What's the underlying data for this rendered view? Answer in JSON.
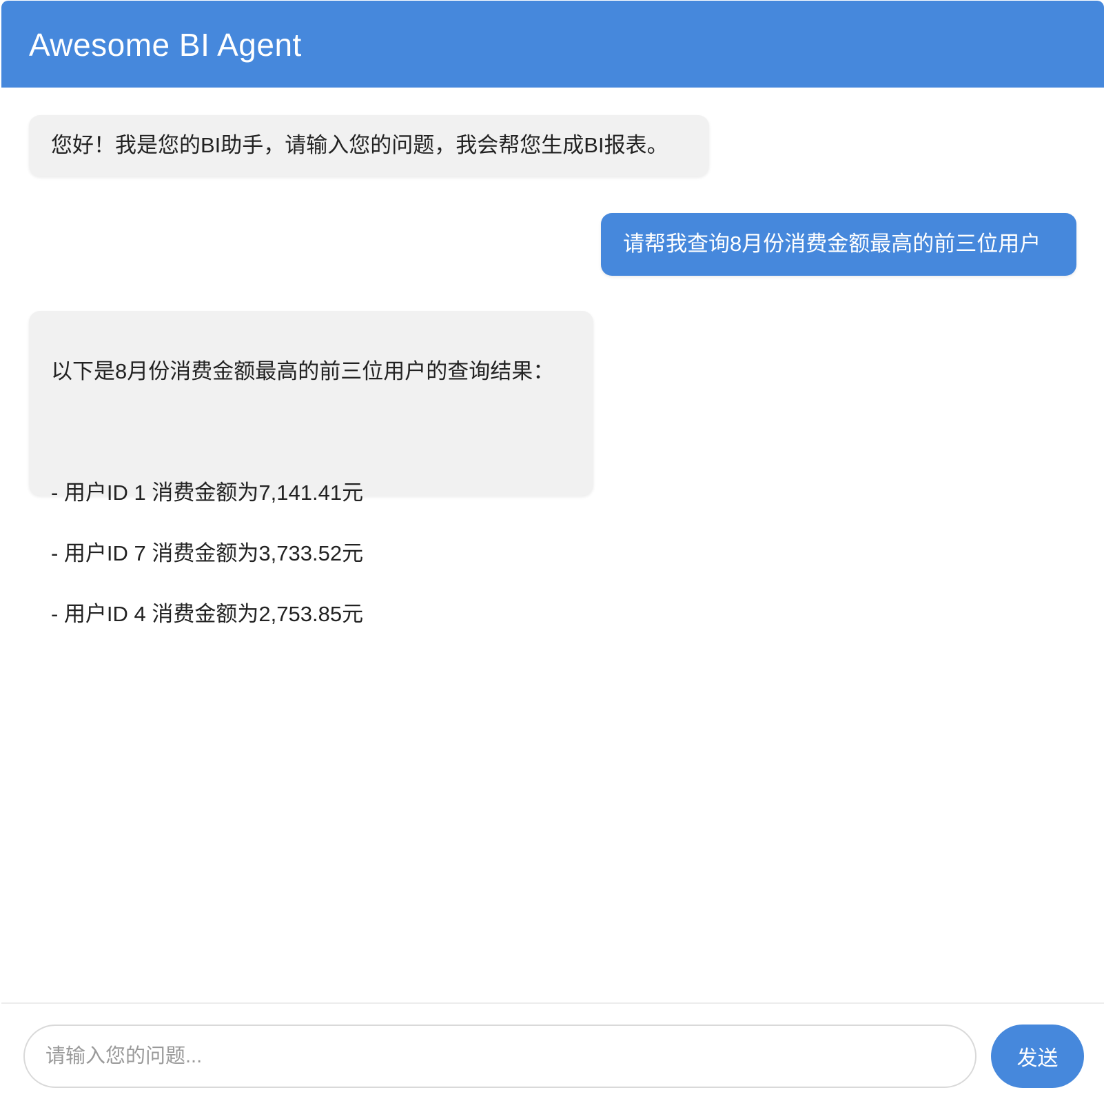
{
  "header": {
    "title": "Awesome BI Agent"
  },
  "messages": [
    {
      "role": "bot",
      "text": "您好！我是您的BI助手，请输入您的问题，我会帮您生成BI报表。"
    },
    {
      "role": "user",
      "text": "请帮我查询8月份消费金额最高的前三位用户"
    },
    {
      "role": "bot",
      "intro": "以下是8月份消费金额最高的前三位用户的查询结果：",
      "items": [
        "- 用户ID 1 消费金额为7,141.41元",
        "- 用户ID 7 消费金额为3,733.52元",
        "- 用户ID 4 消费金额为2,753.85元"
      ]
    }
  ],
  "composer": {
    "placeholder": "请输入您的问题...",
    "value": "",
    "send_label": "发送"
  },
  "colors": {
    "accent": "#4688dc",
    "bot_bubble": "#f1f1f1",
    "text": "#222222"
  }
}
